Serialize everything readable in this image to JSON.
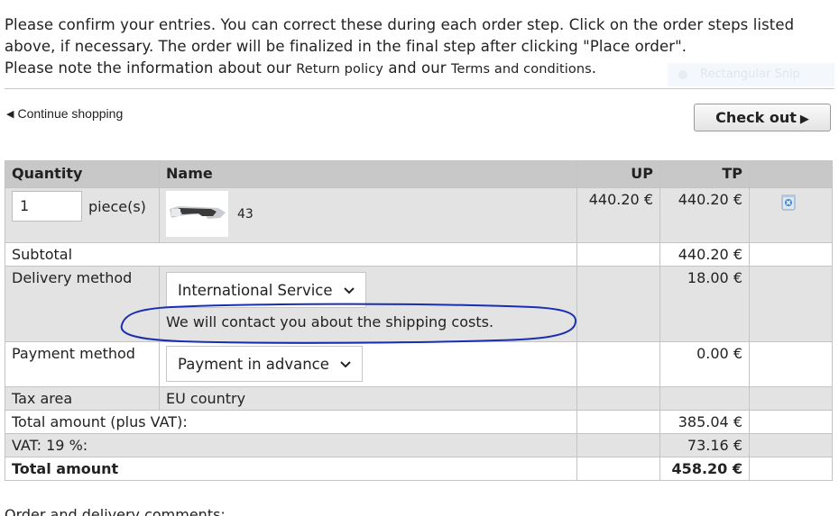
{
  "intro": {
    "line1": "Please confirm your entries. You can correct these during each order step. Click on the order steps listed above, if necessary. The order will be finalized in the final step after clicking \"Place order\".",
    "line2_before": "Please note the information about our ",
    "return_policy": "Return policy",
    "line2_middle": " and our ",
    "terms": "Terms and conditions",
    "line2_end": "."
  },
  "ghost_label": "Rectangular Snip",
  "continue_shopping": "Continue shopping",
  "checkout_button": "Check out",
  "table": {
    "headers": {
      "quantity": "Quantity",
      "name": "Name",
      "up": "UP",
      "tp": "TP"
    },
    "product": {
      "quantity": "1",
      "unit": "piece(s)",
      "name": "43",
      "unit_price": "440.20 €",
      "total_price": "440.20 €"
    },
    "subtotal": {
      "label": "Subtotal",
      "value": "440.20 €"
    },
    "delivery": {
      "label": "Delivery method",
      "selected": "International Service",
      "note": "We will contact you about the shipping costs.",
      "value": "18.00 €"
    },
    "payment": {
      "label": "Payment method",
      "selected": "Payment in advance",
      "value": "0.00 €"
    },
    "tax_area": {
      "label": "Tax area",
      "value": "EU country"
    },
    "total_plus_vat": {
      "label": "Total amount (plus VAT):",
      "value": "385.04 €"
    },
    "vat": {
      "label": "VAT: 19 %:",
      "value": "73.16 €"
    },
    "total": {
      "label": "Total amount",
      "value": "458.20 €"
    }
  },
  "comments_label": "Order and delivery comments:",
  "colors": {
    "header_bg": "#c8c8c8",
    "row_gray": "#e3e3e3",
    "annotation": "#1a2fb0"
  }
}
